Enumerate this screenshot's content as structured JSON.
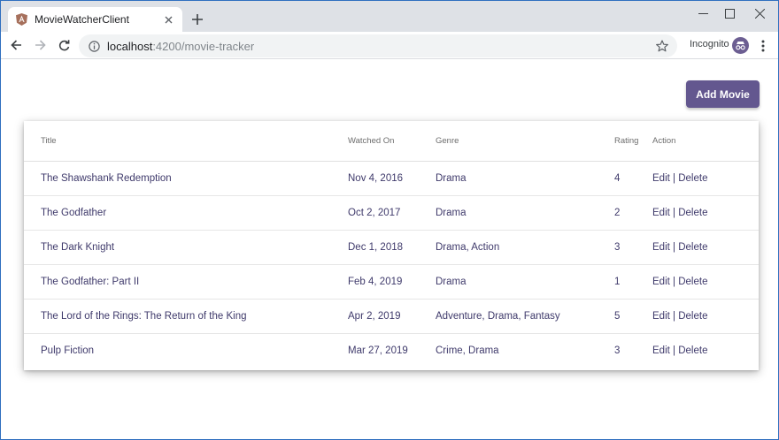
{
  "browser": {
    "tab_title": "MovieWatcherClient",
    "url_host": "localhost",
    "url_rest": ":4200/movie-tracker",
    "incognito_label": "Incognito"
  },
  "page": {
    "add_button_label": "Add Movie",
    "columns": {
      "title": "Title",
      "watched_on": "Watched On",
      "genre": "Genre",
      "rating": "Rating",
      "action": "Action"
    },
    "edit_label": "Edit",
    "separator": "|",
    "delete_label": "Delete",
    "rows": [
      {
        "title": "The Shawshank Redemption",
        "watched_on": "Nov 4, 2016",
        "genre": "Drama",
        "rating": "4"
      },
      {
        "title": "The Godfather",
        "watched_on": "Oct 2, 2017",
        "genre": "Drama",
        "rating": "2"
      },
      {
        "title": "The Dark Knight",
        "watched_on": "Dec 1, 2018",
        "genre": "Drama, Action",
        "rating": "3"
      },
      {
        "title": "The Godfather: Part II",
        "watched_on": "Feb 4, 2019",
        "genre": "Drama",
        "rating": "1"
      },
      {
        "title": "The Lord of the Rings: The Return of the King",
        "watched_on": "Apr 2, 2019",
        "genre": "Adventure, Drama, Fantasy",
        "rating": "5"
      },
      {
        "title": "Pulp Fiction",
        "watched_on": "Mar 27, 2019",
        "genre": "Crime, Drama",
        "rating": "3"
      }
    ]
  },
  "colors": {
    "accent": "#63578f",
    "text": "#3f3a6b",
    "chrome_bg": "#dee1e6"
  },
  "icons": [
    "angular-favicon-icon",
    "close-icon",
    "plus-icon",
    "minimize-icon",
    "maximize-icon",
    "window-close-icon",
    "back-arrow-icon",
    "forward-arrow-icon",
    "reload-icon",
    "info-icon",
    "star-icon",
    "incognito-icon",
    "menu-dots-icon"
  ]
}
